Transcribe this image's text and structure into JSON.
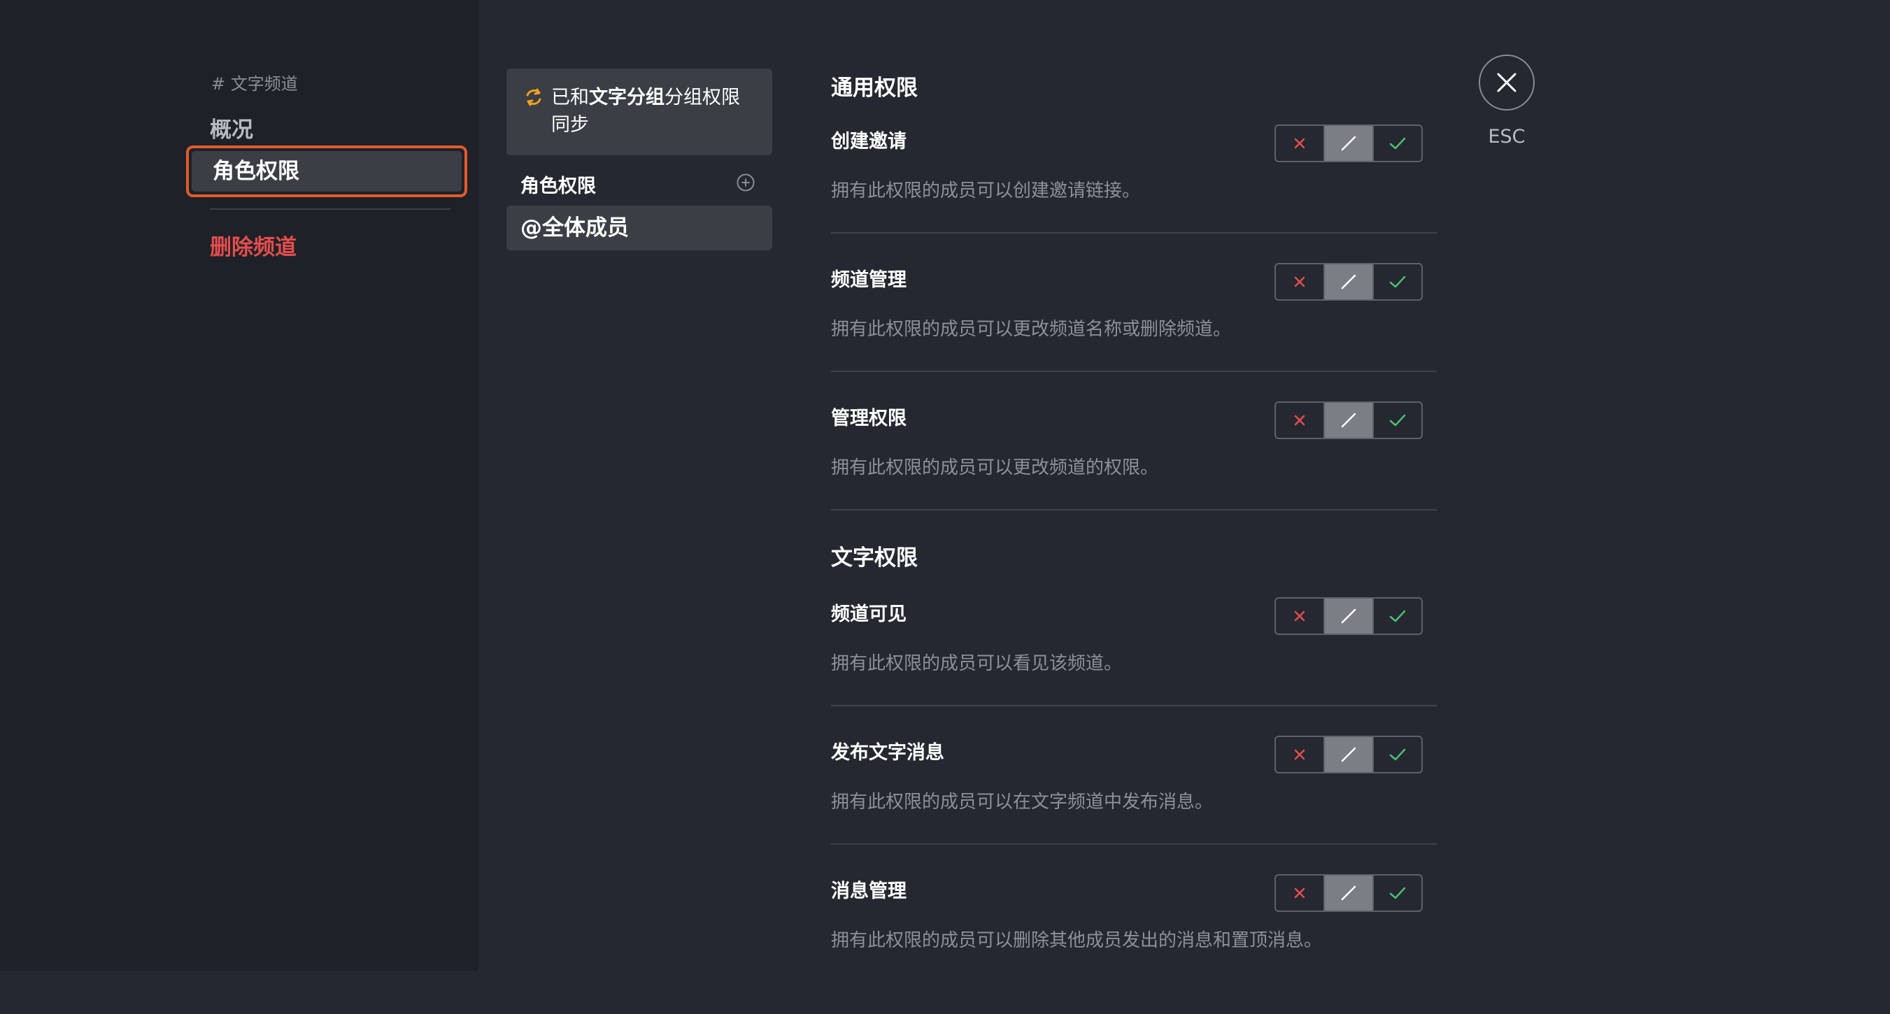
{
  "sidebar": {
    "channel_label": "# 文字频道",
    "items": {
      "overview": "概况",
      "role_permissions": "角色权限",
      "delete_channel": "删除频道"
    }
  },
  "roles_panel": {
    "sync": {
      "prefix": "已和",
      "category": "文字分组",
      "suffix": "分组权限同步"
    },
    "header": "角色权限",
    "selected_role": "@全体成员"
  },
  "sections": {
    "general": {
      "title": "通用权限",
      "permissions": [
        {
          "name": "创建邀请",
          "desc": "拥有此权限的成员可以创建邀请链接。",
          "state": "inherit"
        },
        {
          "name": "频道管理",
          "desc": "拥有此权限的成员可以更改频道名称或删除频道。",
          "state": "inherit"
        },
        {
          "name": "管理权限",
          "desc": "拥有此权限的成员可以更改频道的权限。",
          "state": "inherit"
        }
      ]
    },
    "text": {
      "title": "文字权限",
      "permissions": [
        {
          "name": "频道可见",
          "desc": "拥有此权限的成员可以看见该频道。",
          "state": "inherit"
        },
        {
          "name": "发布文字消息",
          "desc": "拥有此权限的成员可以在文字频道中发布消息。",
          "state": "inherit"
        },
        {
          "name": "消息管理",
          "desc": "拥有此权限的成员可以删除其他成员发出的消息和置顶消息。",
          "state": "inherit"
        }
      ]
    }
  },
  "close": {
    "label": "ESC",
    "icon": "close-icon"
  },
  "colors": {
    "accent_border": "#e25a2a",
    "danger": "#e54d4d",
    "allow": "#4bbf73",
    "sync_icon": "#f0a020"
  }
}
